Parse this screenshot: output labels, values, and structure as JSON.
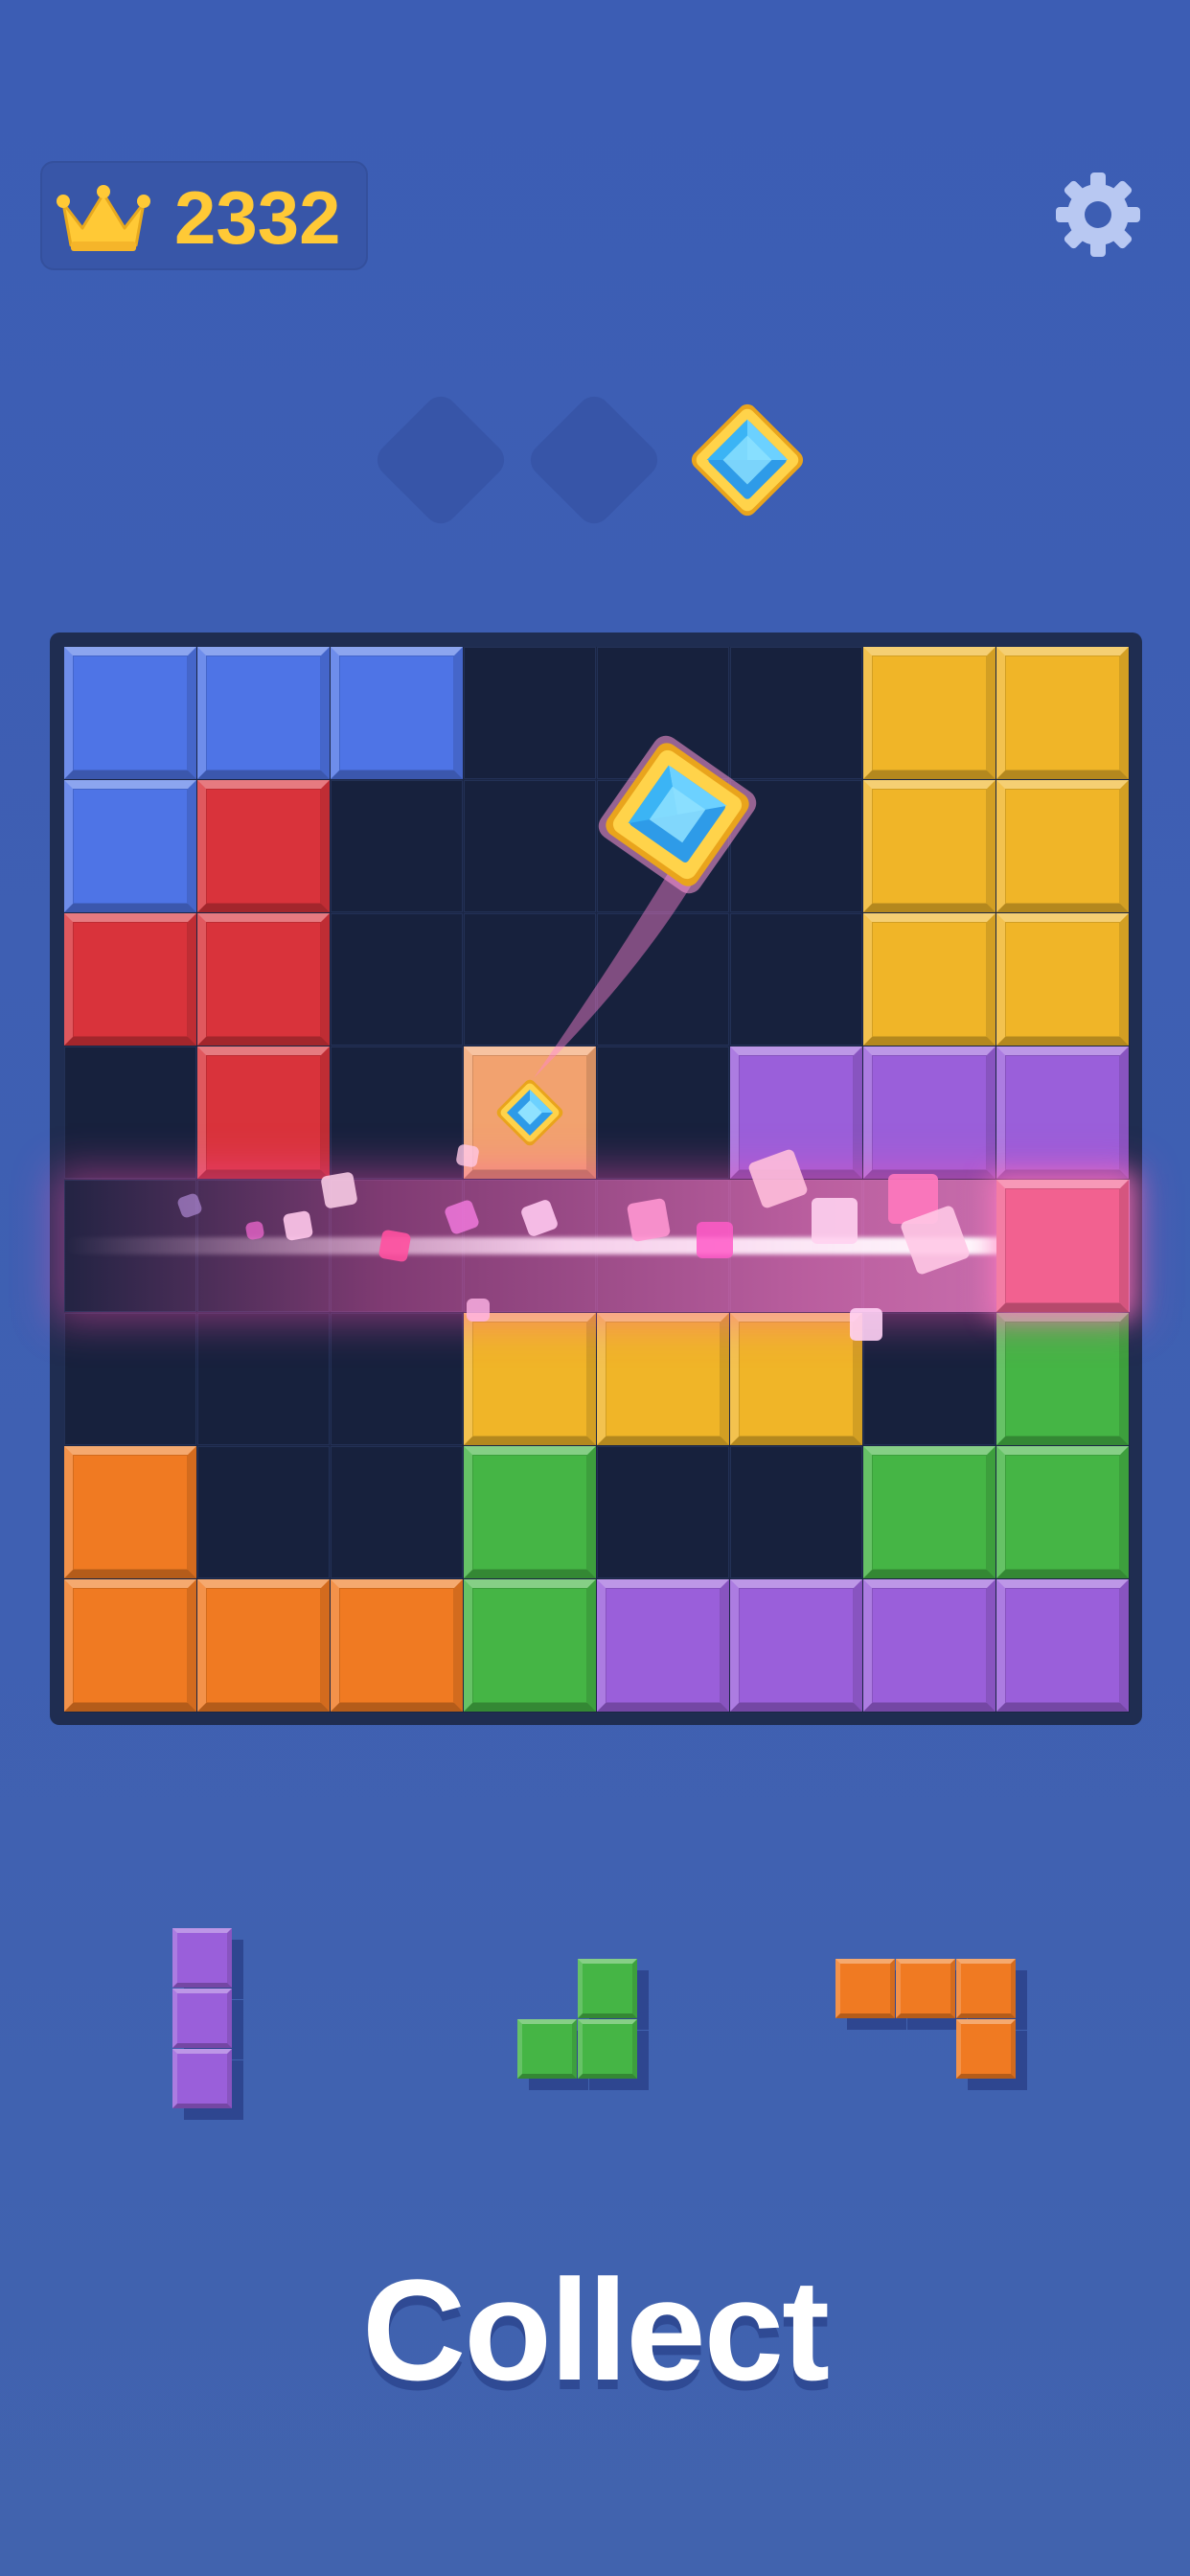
{
  "header": {
    "score": "2332",
    "score_icon": "crown-icon",
    "settings_icon": "gear-icon"
  },
  "goals": {
    "slots": [
      {
        "state": "empty"
      },
      {
        "state": "empty"
      },
      {
        "state": "collected",
        "icon": "blue-diamond-gem-icon"
      }
    ]
  },
  "board": {
    "rows": 8,
    "cols": 8,
    "colors": {
      "B": "#4e74e6",
      "R": "#d9333b",
      "Y": "#f0b528",
      "P": "#9a5fda",
      "O": "#f07a22",
      "G": "#45b545",
      "K": "#f26190",
      "S": "#f2a26f"
    },
    "grid": [
      [
        "B",
        "B",
        "B",
        ".",
        ".",
        ".",
        "Y",
        "Y"
      ],
      [
        "B",
        "R",
        ".",
        ".",
        ".",
        ".",
        "Y",
        "Y"
      ],
      [
        "R",
        "R",
        ".",
        ".",
        ".",
        ".",
        "Y",
        "Y"
      ],
      [
        ".",
        "R",
        ".",
        "S",
        ".",
        "P",
        "P",
        "P"
      ],
      [
        ".",
        ".",
        ".",
        ".",
        ".",
        ".",
        ".",
        "K"
      ],
      [
        ".",
        ".",
        ".",
        "Y",
        "Y",
        "Y",
        ".",
        "G"
      ],
      [
        "O",
        ".",
        ".",
        "G",
        ".",
        ".",
        "G",
        "G"
      ],
      [
        "O",
        "O",
        "O",
        "G",
        "P",
        "P",
        "P",
        "P"
      ]
    ],
    "gem_cell": {
      "row": 3,
      "col": 3,
      "icon": "blue-diamond-gem-icon"
    },
    "cleared_row": 4
  },
  "tray": {
    "pieces": [
      {
        "name": "purple-i3-piece",
        "color": "#9a5fda",
        "cells": [
          [
            0,
            0
          ],
          [
            1,
            0
          ],
          [
            2,
            0
          ]
        ]
      },
      {
        "name": "green-l-piece",
        "color": "#45b545",
        "cells": [
          [
            0,
            1
          ],
          [
            1,
            0
          ],
          [
            1,
            1
          ]
        ]
      },
      {
        "name": "orange-j-piece",
        "color": "#f07a22",
        "cells": [
          [
            0,
            0
          ],
          [
            0,
            1
          ],
          [
            0,
            2
          ],
          [
            1,
            2
          ]
        ]
      }
    ]
  },
  "caption": "Collect"
}
